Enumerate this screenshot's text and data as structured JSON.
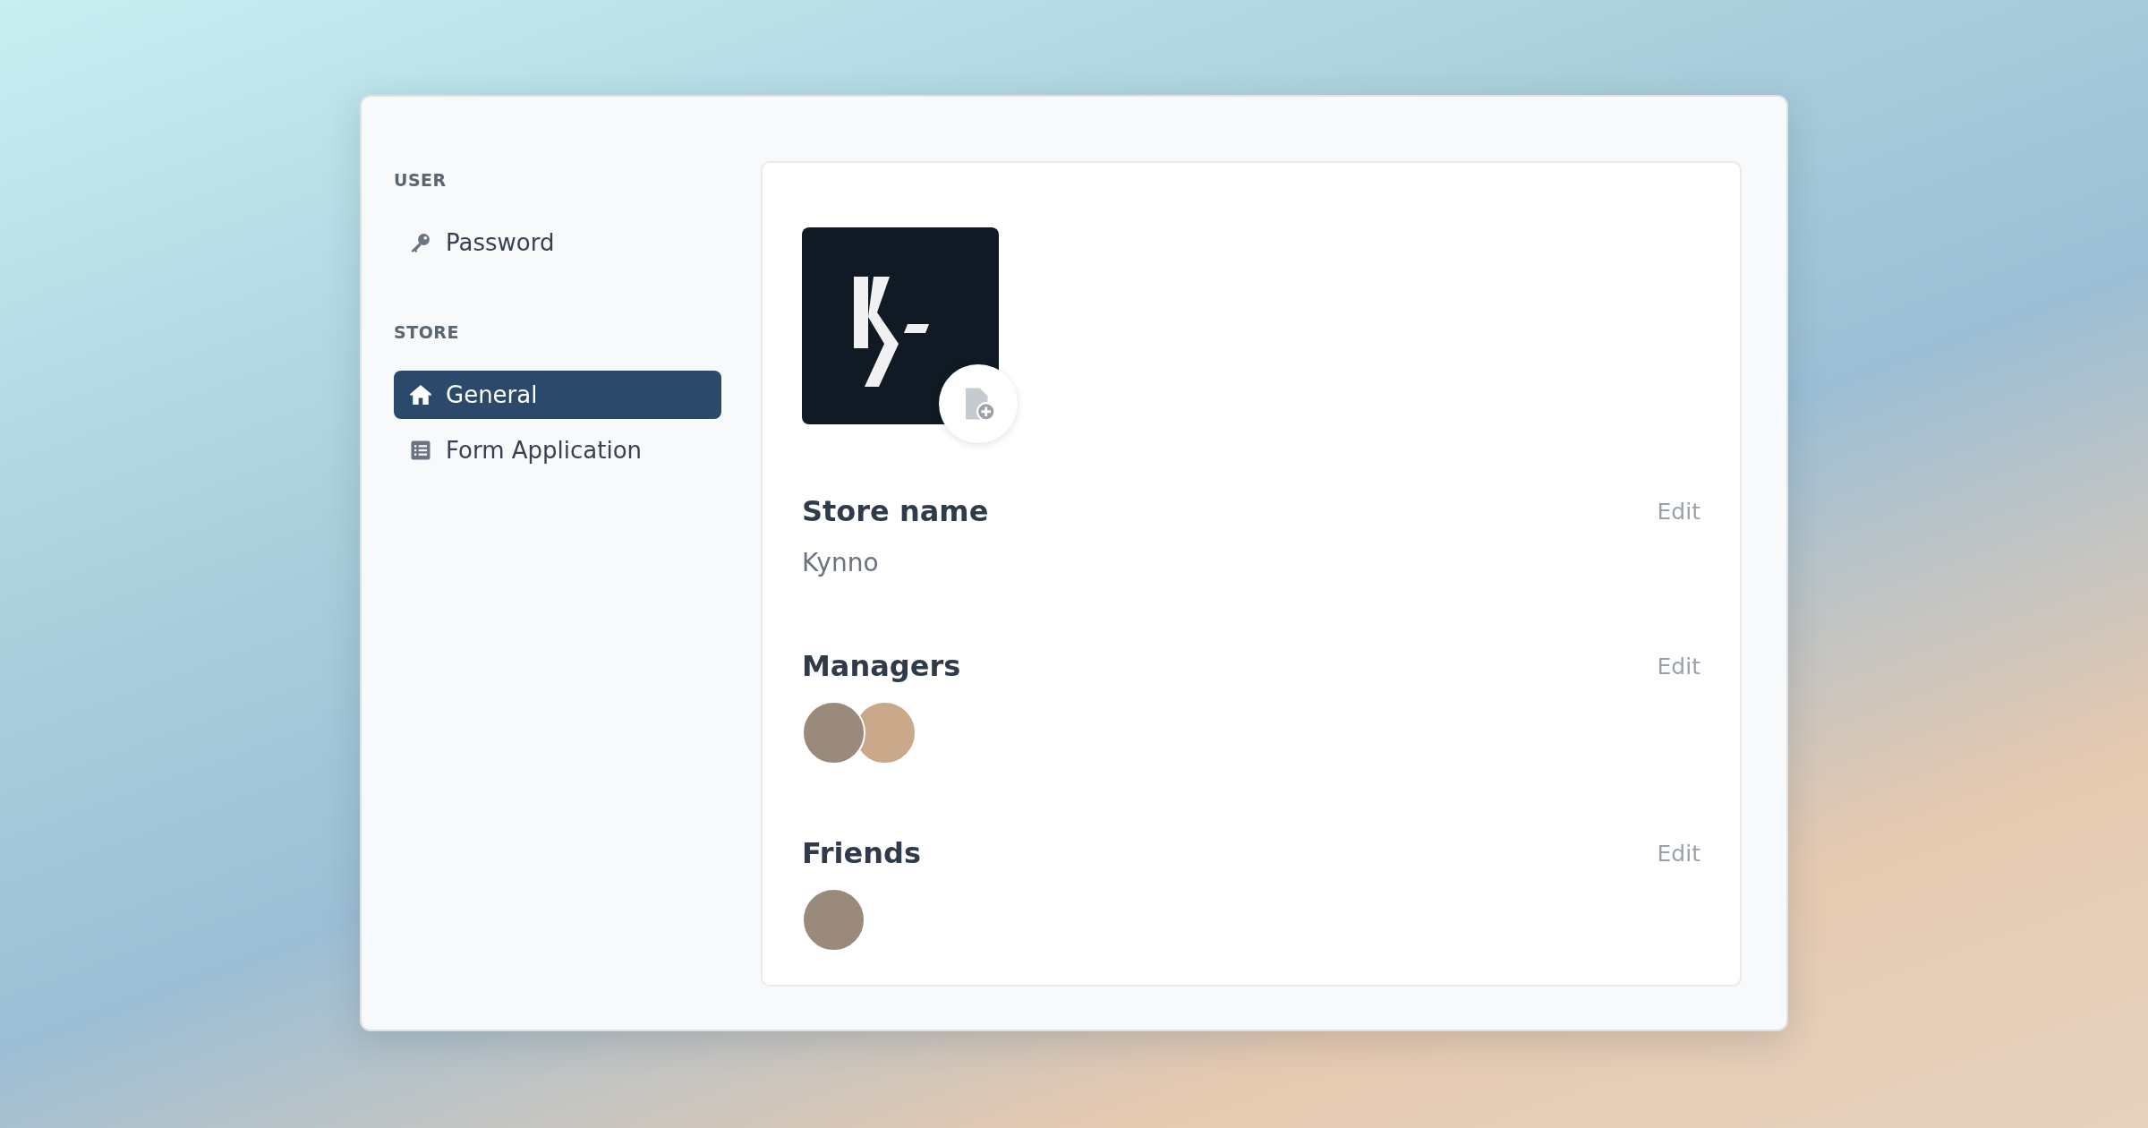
{
  "sidebar": {
    "sections": [
      {
        "heading": "USER",
        "items": [
          {
            "label": "Password",
            "kind": "key",
            "selected": false
          }
        ]
      },
      {
        "heading": "STORE",
        "items": [
          {
            "label": "General",
            "kind": "home",
            "selected": true
          },
          {
            "label": "Form Application",
            "kind": "list",
            "selected": false
          }
        ]
      }
    ]
  },
  "store": {
    "sections": [
      {
        "kind": "text",
        "title": "Store name",
        "action": "Edit",
        "value": "Kynno"
      },
      {
        "kind": "people",
        "title": "Managers",
        "action": "Edit",
        "people": [
          {
            "kind": "photo"
          },
          {
            "kind": "photo"
          }
        ]
      },
      {
        "kind": "people",
        "title": "Friends",
        "action": "Edit",
        "people": [
          {
            "kind": "photo"
          }
        ]
      }
    ]
  }
}
